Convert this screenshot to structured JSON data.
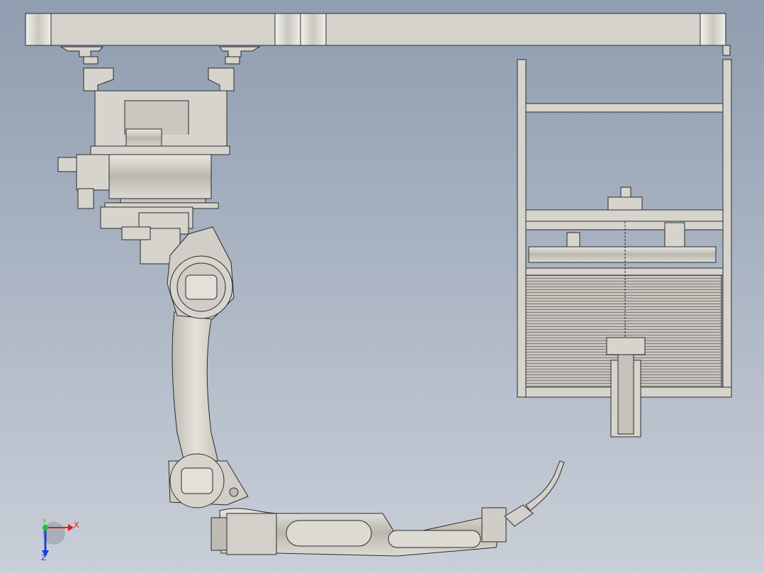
{
  "view": {
    "background_top": "#8f9db0",
    "background_bottom": "#c9cfd8",
    "part_fill": "#d6d4cc",
    "part_stroke": "#2b2b2b"
  },
  "triad": {
    "x_label": "X",
    "y_label": "Y",
    "z_label": "Z",
    "x_color": "#e01b1b",
    "y_color": "#22c322",
    "z_color": "#1f3fd8"
  }
}
